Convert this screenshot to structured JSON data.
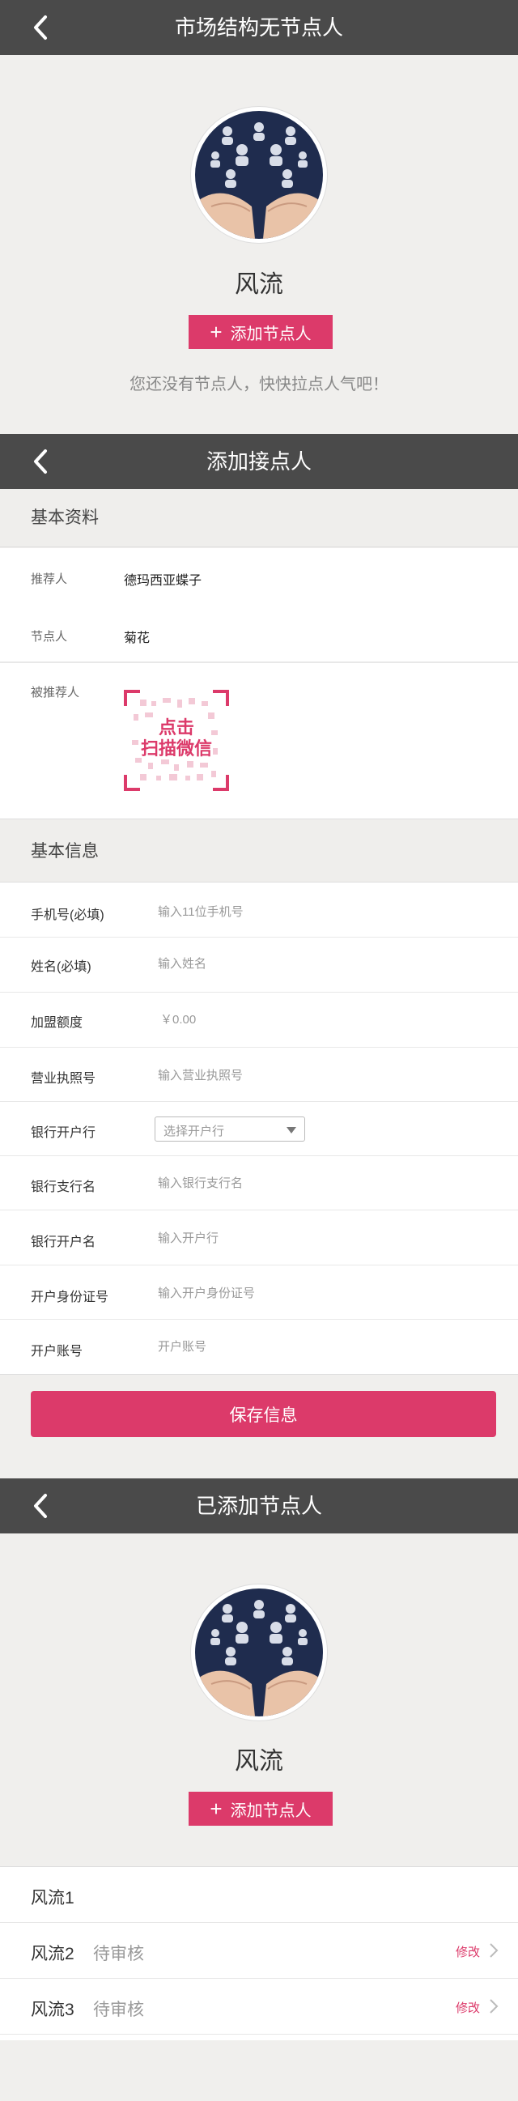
{
  "section1": {
    "title": "市场结构无节点人",
    "username": "风流",
    "add_button": "添加节点人",
    "empty_hint": "您还没有节点人，快快拉点人气吧！"
  },
  "section2": {
    "title": "添加接点人",
    "basic_profile": {
      "heading": "基本资料",
      "rows": [
        {
          "label": "推荐人",
          "value": "德玛西亚蝶子"
        },
        {
          "label": "节点人",
          "value": "菊花"
        },
        {
          "label": "被推荐人",
          "value": ""
        }
      ],
      "qr_text_line1": "点击",
      "qr_text_line2": "扫描微信"
    },
    "basic_info": {
      "heading": "基本信息",
      "fields": [
        {
          "label": "手机号(必填)",
          "placeholder": "输入11位手机号"
        },
        {
          "label": "姓名(必填)",
          "placeholder": "输入姓名"
        },
        {
          "label": "加盟额度",
          "placeholder": "￥0.00"
        },
        {
          "label": "营业执照号",
          "placeholder": "输入营业执照号"
        },
        {
          "label": "银行开户行",
          "placeholder": "选择开户行"
        },
        {
          "label": "银行支行名",
          "placeholder": "输入银行支行名"
        },
        {
          "label": "银行开户名",
          "placeholder": "输入开户行"
        },
        {
          "label": "开户身份证号",
          "placeholder": "输入开户身份证号"
        },
        {
          "label": "开户账号",
          "placeholder": "开户账号"
        }
      ]
    },
    "save_button": "保存信息"
  },
  "section3": {
    "title": "已添加节点人",
    "username": "风流",
    "add_button": "添加节点人",
    "list": [
      {
        "name": "风流1",
        "status": "",
        "edit": ""
      },
      {
        "name": "风流2",
        "status": "待审核",
        "edit": "修改"
      },
      {
        "name": "风流3",
        "status": "待审核",
        "edit": "修改"
      }
    ]
  },
  "colors": {
    "navbar": "#4a4a4a",
    "accent": "#dc3a6a",
    "background": "#f0efed"
  },
  "icons": [
    "back-arrow-icon",
    "plus-icon",
    "dropdown-caret-icon",
    "chevron-right-icon",
    "qr-code-icon"
  ]
}
